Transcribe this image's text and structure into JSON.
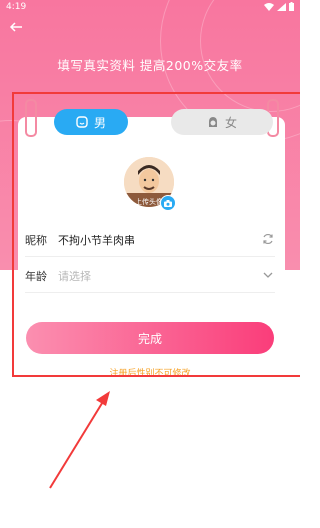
{
  "status_bar": {
    "time": "4:19"
  },
  "header": {
    "title": "填写真实资料 提高200%交友率"
  },
  "gender": {
    "male_label": "男",
    "female_label": "女",
    "selected": "男"
  },
  "avatar": {
    "overlay_label": "上传头像"
  },
  "form": {
    "nickname_label": "昵称",
    "nickname_value": "不拘小节羊肉串",
    "age_label": "年龄",
    "age_placeholder": "请选择"
  },
  "submit_label": "完成",
  "note": "注册后性别不可修改",
  "colors": {
    "header_pink": "#f8769f",
    "male_blue": "#29aaf3",
    "button_gradient_start": "#fb8fb0",
    "button_gradient_end": "#fa3d7a",
    "note_orange": "#f6a024",
    "annotation_red": "#f23a3a"
  }
}
